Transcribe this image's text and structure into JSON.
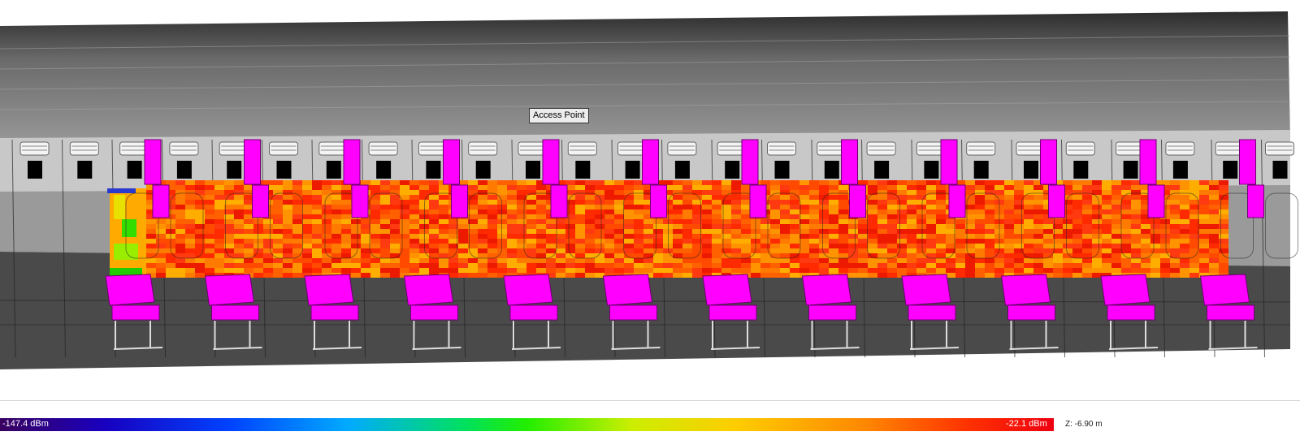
{
  "access_point": {
    "label": "Access Point"
  },
  "legend": {
    "min_label": "-147.4 dBm",
    "max_label": "-22.1 dBm",
    "z_readout": "Z: -6.90 m"
  },
  "colors": {
    "seat_magenta": "#ff00ff",
    "heat_hot": "#ff3000",
    "heat_warm": "#ff8800",
    "cabin_wall": "#8c8c8c",
    "cabin_floor": "#4a4a4a"
  },
  "scene": {
    "seat_rows": 12,
    "heatmap_units": "dBm"
  }
}
